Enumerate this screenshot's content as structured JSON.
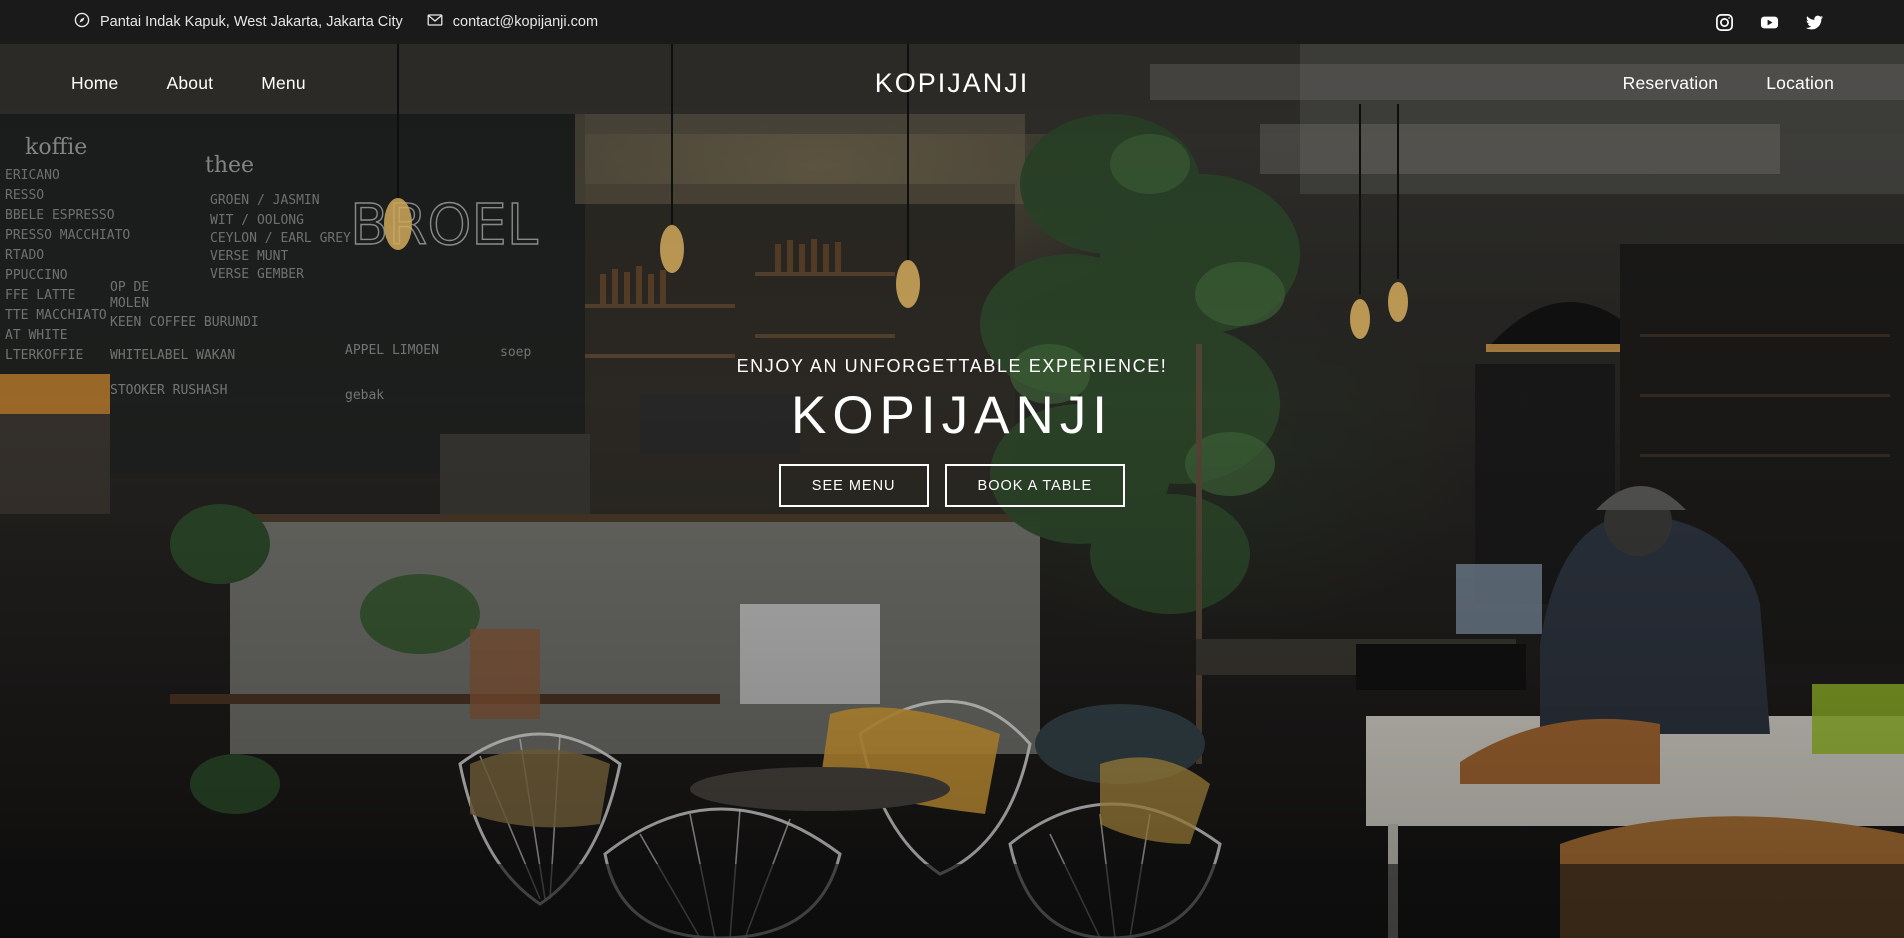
{
  "topbar": {
    "address": "Pantai Indak Kapuk, West Jakarta, Jakarta City",
    "address_icon": "compass-icon",
    "email": "contact@kopijanji.com",
    "email_icon": "envelope-icon",
    "socials": [
      "instagram-icon",
      "youtube-icon",
      "twitter-icon"
    ]
  },
  "nav": {
    "left": [
      "Home",
      "About",
      "Menu"
    ],
    "brand": "KOPIJANJI",
    "right": [
      "Reservation",
      "Location"
    ]
  },
  "hero": {
    "tagline": "ENJOY AN UNFORGETTABLE EXPERIENCE!",
    "title": "KOPIJANJI",
    "buttons": [
      "SEE MENU",
      "BOOK A TABLE"
    ],
    "background_image": "cafe interior with chalkboard menu, bar counter, plants and seating"
  },
  "colors": {
    "topbar_bg": "#1a1a1a",
    "text": "#ffffff",
    "accent": "#e0a93a"
  }
}
